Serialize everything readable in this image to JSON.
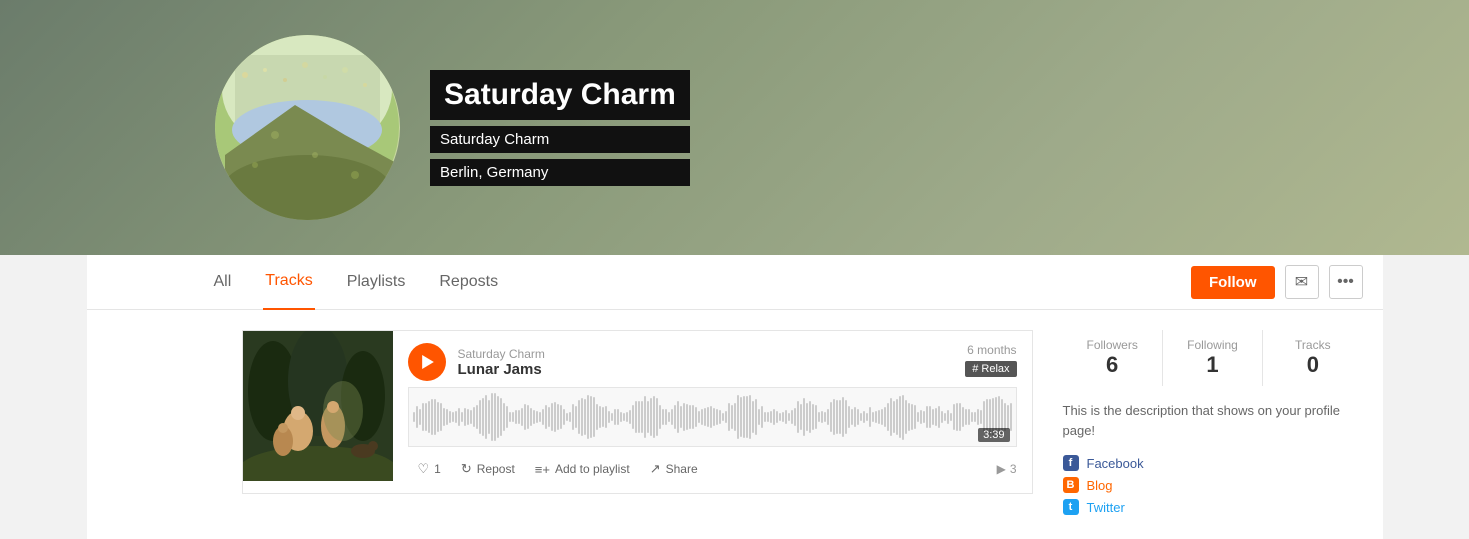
{
  "banner": {
    "title": "Saturday Charm",
    "username": "Saturday Charm",
    "location": "Berlin, Germany"
  },
  "nav": {
    "tabs": [
      {
        "id": "all",
        "label": "All",
        "active": false
      },
      {
        "id": "tracks",
        "label": "Tracks",
        "active": true
      },
      {
        "id": "playlists",
        "label": "Playlists",
        "active": false
      },
      {
        "id": "reposts",
        "label": "Reposts",
        "active": false
      }
    ],
    "follow_label": "Follow",
    "email_icon": "✉",
    "more_icon": "···"
  },
  "track": {
    "artist": "Saturday Charm",
    "title": "Lunar Jams",
    "time_ago": "6 months",
    "tag": "# Relax",
    "duration": "3:39",
    "like_count": "1",
    "repost_label": "Repost",
    "add_playlist_label": "Add to playlist",
    "share_label": "Share",
    "play_count": "3"
  },
  "sidebar": {
    "followers_label": "Followers",
    "followers_count": "6",
    "following_label": "Following",
    "following_count": "1",
    "tracks_label": "Tracks",
    "tracks_count": "0",
    "description": "This is the description that shows on your profile page!",
    "social": [
      {
        "id": "facebook",
        "label": "Facebook",
        "icon": "f",
        "type": "fb"
      },
      {
        "id": "blog",
        "label": "Blog",
        "icon": "b",
        "type": "blog"
      },
      {
        "id": "twitter",
        "label": "Twitter",
        "icon": "t",
        "type": "tw"
      }
    ]
  }
}
